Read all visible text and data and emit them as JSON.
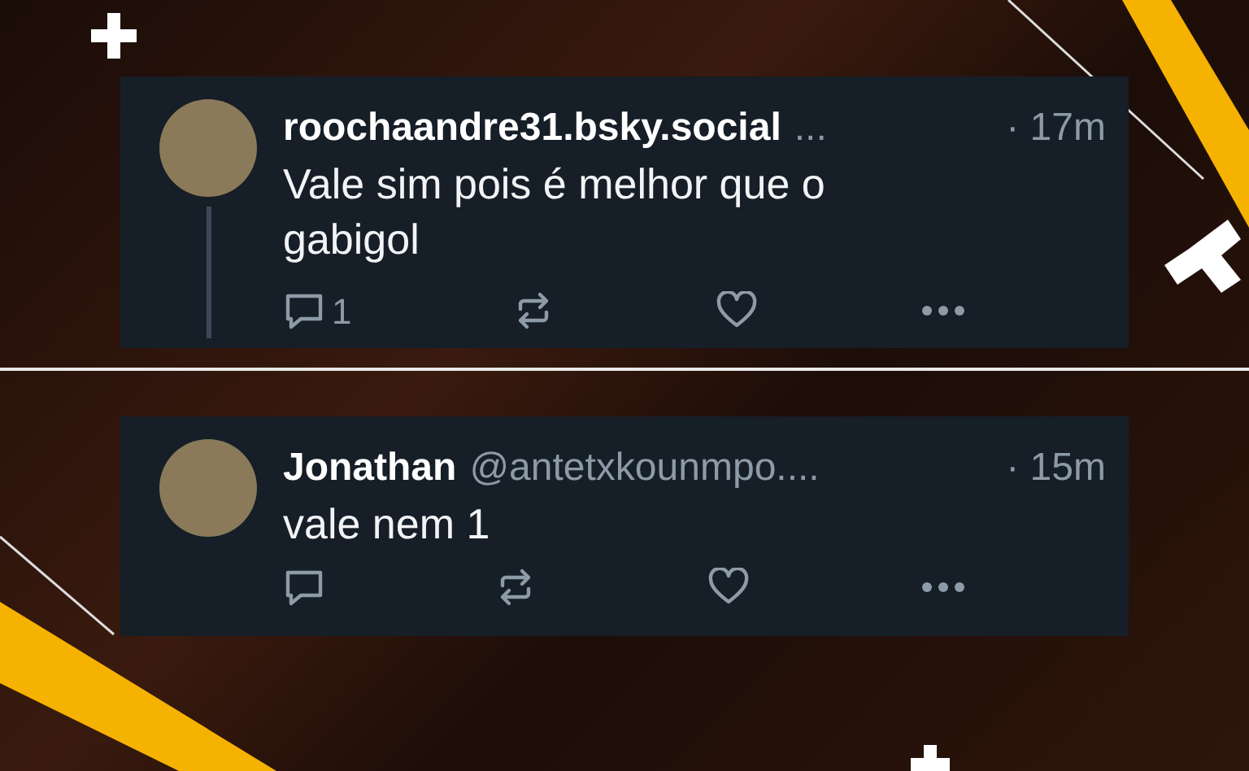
{
  "posts": [
    {
      "display_name": "roochaandre31.bsky.social",
      "handle": "...",
      "time": "· 17m",
      "text": "Vale sim pois é melhor que o gabigol",
      "reply_count": "1",
      "thread_line": true
    },
    {
      "display_name": "Jonathan",
      "handle": "@antetxkounmpo....",
      "time": "· 15m",
      "text": "vale nem 1",
      "thread_line": false
    }
  ]
}
